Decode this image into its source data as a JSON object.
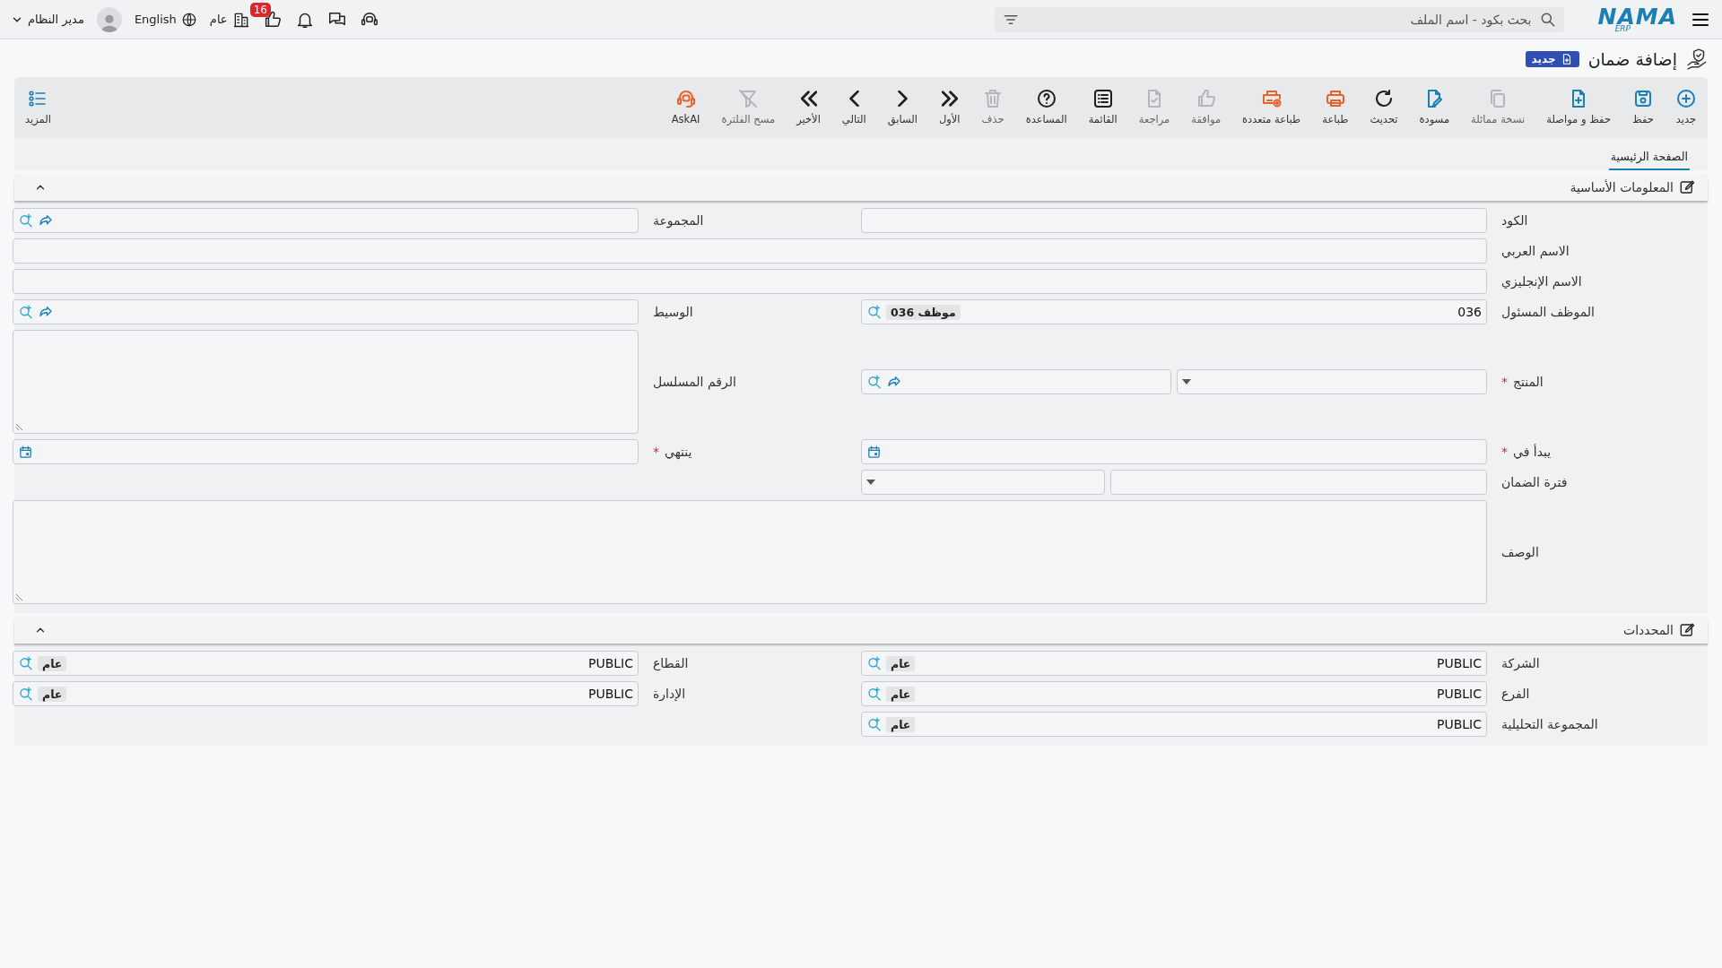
{
  "topbar": {
    "logo": {
      "name": "NAMA",
      "sub": "ERP"
    },
    "search": {
      "placeholder": "بحث بكود - اسم الملف"
    },
    "notifications": "16",
    "company": "عام",
    "language": "English",
    "user": "مدير النظام"
  },
  "page": {
    "title": "إضافة ضمان",
    "badge": "جديد"
  },
  "toolbar": [
    {
      "kind": "new",
      "label": "جديد",
      "color": "#1a7fb5",
      "disabled": false
    },
    {
      "kind": "save",
      "label": "حفظ",
      "color": "#1a7fb5",
      "disabled": false
    },
    {
      "kind": "save-continue",
      "label": "حفظ و مواصلة",
      "color": "#1a7fb5",
      "disabled": false
    },
    {
      "kind": "duplicate",
      "label": "نسخة مماثلة",
      "disabled": true
    },
    {
      "kind": "draft",
      "label": "مسودة",
      "color": "#1a7fb5",
      "disabled": false
    },
    {
      "kind": "refresh",
      "label": "تحديث",
      "color": "#1f1f1f",
      "disabled": false
    },
    {
      "kind": "print",
      "label": "طباعة",
      "color": "#e8622a",
      "disabled": false
    },
    {
      "kind": "multi-print",
      "label": "طباعة متعددة",
      "color": "#e8622a",
      "disabled": false
    },
    {
      "kind": "approve",
      "label": "موافقة",
      "disabled": true
    },
    {
      "kind": "review",
      "label": "مراجعة",
      "disabled": true
    },
    {
      "kind": "list",
      "label": "القائمة",
      "color": "#1f1f1f",
      "disabled": false
    },
    {
      "kind": "help",
      "label": "المساعدة",
      "color": "#1f1f1f",
      "disabled": false
    },
    {
      "kind": "delete",
      "label": "حذف",
      "disabled": true
    },
    {
      "kind": "first",
      "label": "الأول",
      "color": "#1f1f1f",
      "disabled": false
    },
    {
      "kind": "previous",
      "label": "السابق",
      "color": "#1f1f1f",
      "disabled": false
    },
    {
      "kind": "next",
      "label": "التالي",
      "color": "#1f1f1f",
      "disabled": false
    },
    {
      "kind": "last",
      "label": "الأخير",
      "color": "#1f1f1f",
      "disabled": false
    },
    {
      "kind": "clear-filter",
      "label": "مسح الفلترة",
      "disabled": true
    },
    {
      "kind": "ask-ai",
      "label": "AskAI",
      "color": "#e8622a",
      "disabled": false
    }
  ],
  "more": {
    "label": "المزيد"
  },
  "tabs": [
    {
      "label": "الصفحة الرئيسية",
      "selected": true
    }
  ],
  "sections": [
    {
      "title": "المعلومات الأساسية",
      "expanded": true,
      "rows": [
        [
          {
            "label": "الكود",
            "kind": "text"
          },
          {
            "label": "المجموعة",
            "kind": "lookup",
            "open_link": true
          }
        ],
        [
          {
            "label": "الاسم العربي",
            "kind": "text",
            "full_width": true
          }
        ],
        [
          {
            "label": "الاسم الإنجليزي",
            "kind": "text",
            "full_width": true
          }
        ],
        [
          {
            "label": "الموظف المسئول",
            "kind": "lookup",
            "value": "036",
            "tag": "موظف 036"
          },
          {
            "label": "الوسيط",
            "kind": "lookup",
            "open_link": true
          }
        ],
        [
          {
            "label": "المنتج",
            "kind": "select-lookup",
            "required_mark": "*",
            "open_link": true
          },
          {
            "label": "الرقم المسلسل",
            "kind": "textarea"
          }
        ],
        [
          {
            "label": "يبدأ في",
            "kind": "date",
            "required_mark": "*"
          },
          {
            "label": "ينتهي",
            "kind": "date",
            "required_mark": "*"
          }
        ],
        [
          {
            "label": "فترة الضمان",
            "kind": "text-select"
          }
        ],
        [
          {
            "label": "الوصف",
            "kind": "textarea",
            "full_width": true
          }
        ]
      ]
    },
    {
      "title": "المحددات",
      "expanded": true,
      "rows": [
        [
          {
            "label": "الشركة",
            "kind": "lookup",
            "value": "PUBLIC",
            "tag": "عام"
          },
          {
            "label": "القطاع",
            "kind": "lookup",
            "value": "PUBLIC",
            "tag": "عام"
          }
        ],
        [
          {
            "label": "الفرع",
            "kind": "lookup",
            "value": "PUBLIC",
            "tag": "عام"
          },
          {
            "label": "الإدارة",
            "kind": "lookup",
            "value": "PUBLIC",
            "tag": "عام"
          }
        ],
        [
          {
            "label": "المجموعة التحليلية",
            "kind": "lookup",
            "value": "PUBLIC",
            "tag": "عام"
          }
        ]
      ]
    }
  ]
}
